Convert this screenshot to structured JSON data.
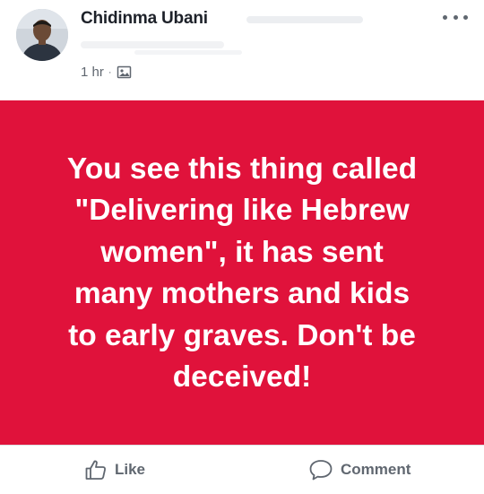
{
  "post": {
    "author": "Chidinma Ubani",
    "time": "1 hr",
    "separator": "·",
    "audience_icon": "photo-icon",
    "more_icon": "more-options-icon",
    "text_lines": [
      "You see this thing called",
      "\"Delivering like Hebrew",
      "women\", it has sent",
      "many mothers and kids",
      "to early graves. Don't be",
      "deceived!"
    ],
    "background_color": "#e0123b",
    "text_color": "#ffffff"
  },
  "actions": {
    "like_label": "Like",
    "like_icon": "thumbs-up-icon",
    "comment_label": "Comment",
    "comment_icon": "speech-bubble-icon"
  }
}
